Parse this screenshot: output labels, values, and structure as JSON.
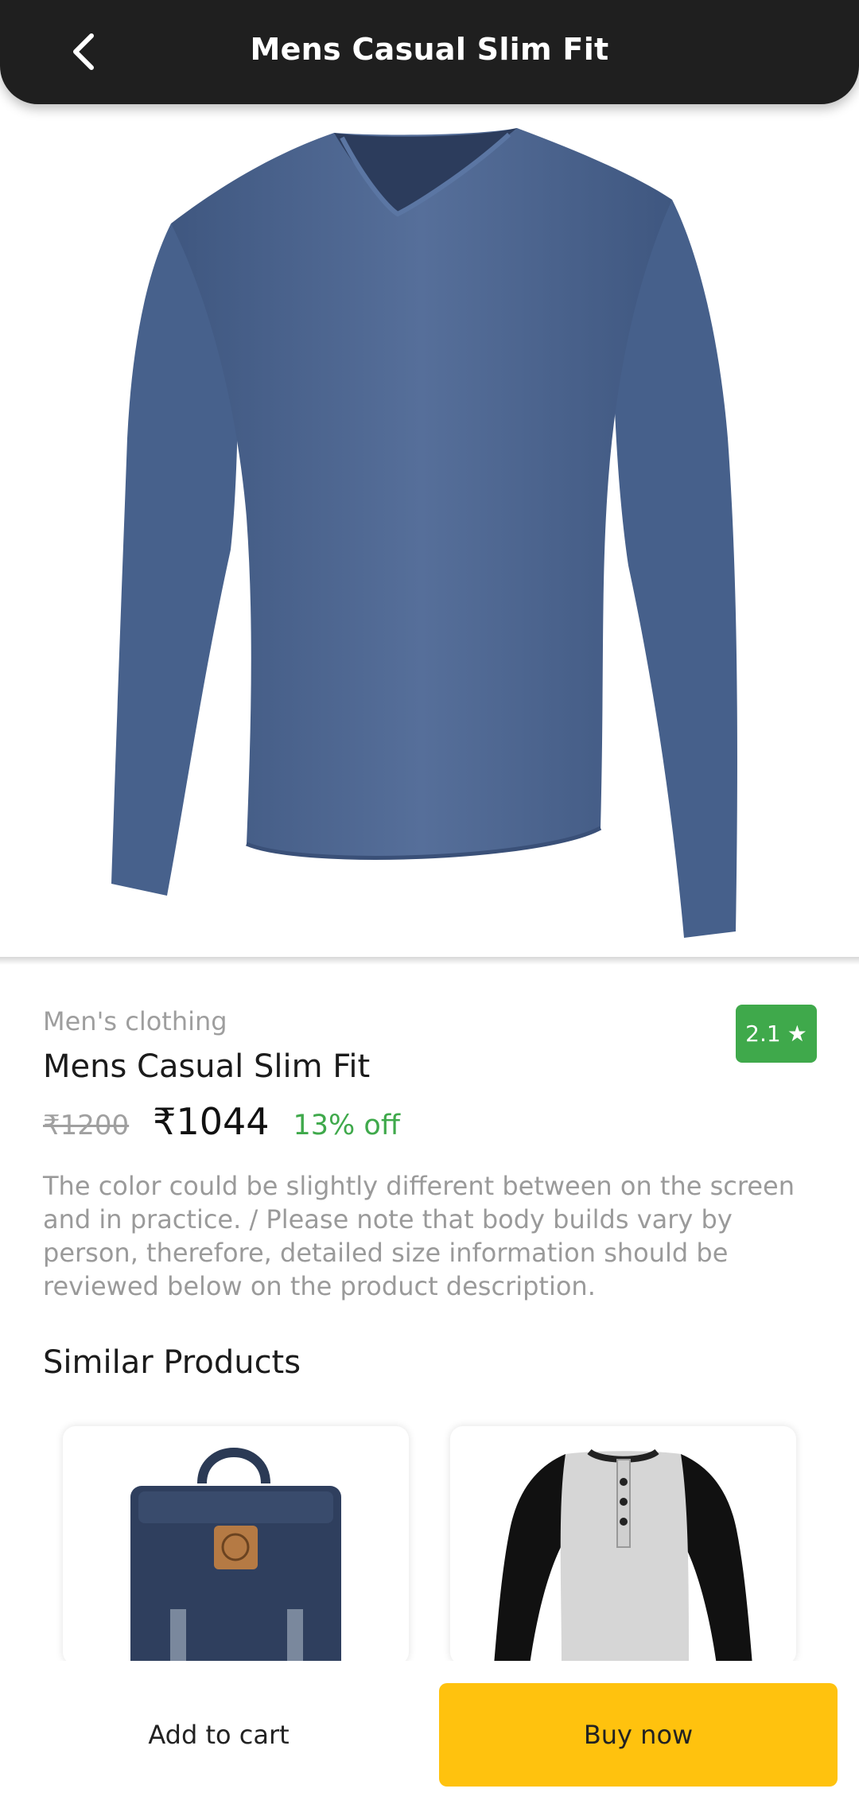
{
  "header": {
    "title": "Mens Casual Slim Fit"
  },
  "icons": {
    "back": "chevron-left-icon",
    "star": "star-icon"
  },
  "product": {
    "category": "Men's clothing",
    "title": "Mens Casual Slim Fit",
    "rating": "2.1",
    "old_price": "₹1200",
    "new_price": "₹1044",
    "discount": "13% off",
    "description": "The color could be slightly different between on the screen and in practice. / Please note that body builds vary by person, therefore, detailed size information should be reviewed below on the product description.",
    "image_count": 2,
    "active_image": 1
  },
  "similar": {
    "title": "Similar Products"
  },
  "actions": {
    "add_to_cart": "Add to cart",
    "buy_now": "Buy now"
  },
  "colors": {
    "header_bg": "#1f1f1f",
    "rating_green": "#3fa94b",
    "buy_yellow": "#ffc20e",
    "shirt_blue": "#4d6590"
  }
}
